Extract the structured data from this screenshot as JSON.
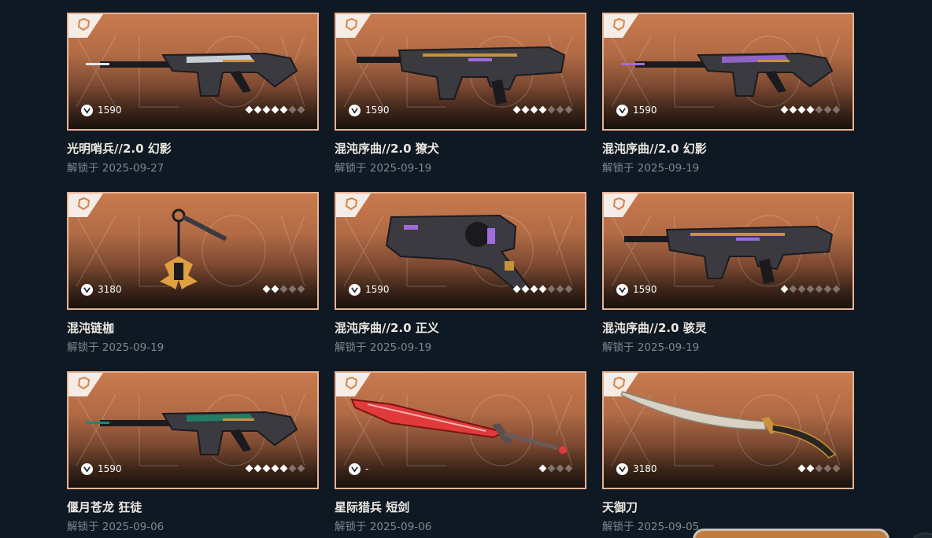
{
  "items": [
    {
      "name": "光明哨兵//2.0 幻影",
      "date": "解锁于 2025-09-27",
      "price": "1590",
      "rating": 5,
      "rating_max": 7,
      "weapon": "rifle-icon",
      "accent": "#dfe7ee"
    },
    {
      "name": "混沌序曲//2.0 獠犬",
      "date": "解锁于 2025-09-19",
      "price": "1590",
      "rating": 4,
      "rating_max": 7,
      "weapon": "smg-icon",
      "accent": "#a06cdc"
    },
    {
      "name": "混沌序曲//2.0 幻影",
      "date": "解锁于 2025-09-19",
      "price": "1590",
      "rating": 4,
      "rating_max": 7,
      "weapon": "rifle-icon",
      "accent": "#a06cdc"
    },
    {
      "name": "混沌链枷",
      "date": "解锁于 2025-09-19",
      "price": "3180",
      "rating": 2,
      "rating_max": 5,
      "weapon": "flail-icon",
      "accent": "#e0a040"
    },
    {
      "name": "混沌序曲//2.0 正义",
      "date": "解锁于 2025-09-19",
      "price": "1590",
      "rating": 4,
      "rating_max": 7,
      "weapon": "revolver-icon",
      "accent": "#a06cdc"
    },
    {
      "name": "混沌序曲//2.0 骇灵",
      "date": "解锁于 2025-09-19",
      "price": "1590",
      "rating": 1,
      "rating_max": 7,
      "weapon": "smg-icon",
      "accent": "#a06cdc"
    },
    {
      "name": "偃月苍龙 狂徒",
      "date": "解锁于 2025-09-06",
      "price": "1590",
      "rating": 5,
      "rating_max": 7,
      "weapon": "rifle-icon",
      "accent": "#1f8a6c"
    },
    {
      "name": "星际猎兵 短剑",
      "date": "解锁于 2025-09-06",
      "price": "-",
      "rating": 1,
      "rating_max": 4,
      "weapon": "sword-icon",
      "accent": "#e03a3a"
    },
    {
      "name": "天御刀",
      "date": "解锁于 2025-09-05",
      "price": "3180",
      "rating": 2,
      "rating_max": 5,
      "weapon": "blade-icon",
      "accent": "#d8d2c4"
    }
  ],
  "icons": {
    "currency": "valorant-points-icon",
    "tier": "tier-badge-icon"
  },
  "colors": {
    "background": "#0f1923",
    "card_border": "#e8b393",
    "card_top": "#c97a4e",
    "name_text": "#ece8e1",
    "date_text": "#7d8893"
  }
}
